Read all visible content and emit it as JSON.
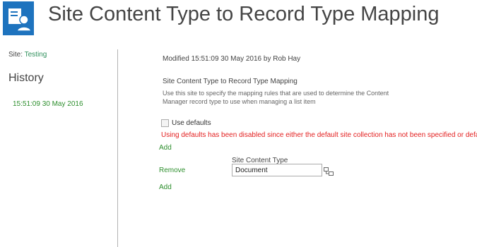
{
  "header": {
    "title": "Site Content Type to Record Type Mapping",
    "logo_icon": "records-management-icon",
    "brand_color": "#1e73be"
  },
  "nav": {
    "site_prefix": "Site:",
    "site_name": "Testing",
    "history_heading": "History",
    "history_items": [
      {
        "label": "15:51:09 30 May 2016"
      }
    ]
  },
  "main": {
    "modified_text": "Modified 15:51:09 30 May 2016 by Rob Hay",
    "section_title": "Site Content Type to Record Type Mapping",
    "section_description": "Use this site to specify the mapping rules that are used to determine the Content Manager record type to use when managing a list item",
    "use_defaults_label": "Use defaults",
    "use_defaults_checked": false,
    "error_text": "Using defaults has been disabled since either the default site collection has not been specified or defaults",
    "add_label": "Add",
    "remove_label": "Remove",
    "column_label": "Site Content Type",
    "content_type_value": "Document",
    "browse_icon": "browse-icon"
  },
  "colors": {
    "link_green": "#2e8f2e",
    "error_red": "#e32020"
  }
}
